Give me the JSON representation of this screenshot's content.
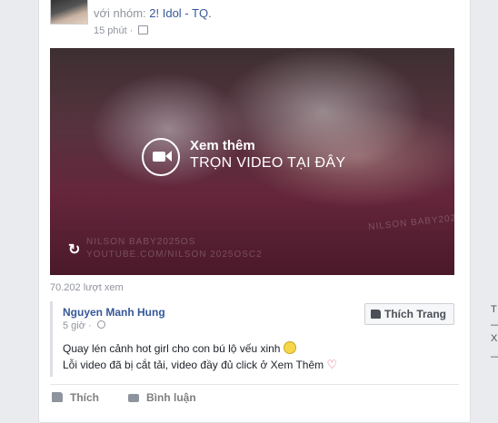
{
  "post": {
    "prefix": "với nhóm:",
    "group": "2! Idol - TQ.",
    "time": "15 phút",
    "privacy_icon": "audience-icon"
  },
  "video": {
    "cta_line1": "Xem thêm",
    "cta_line2": "TRỌN VIDEO TẠI ĐÂY",
    "watermark1": "NILSON BABY2025OSOS",
    "watermark2": "NILSON BABY2025OS",
    "watermark3": "YOUTUBE.COM/NILSON 2025OSC2",
    "replay_symbol": "↻",
    "views": "70.202 lượt xem"
  },
  "shared": {
    "author": "Nguyen Manh Hung",
    "time": "5 giờ ·",
    "like_page_label": "Thích Trang",
    "line1": "Quay lén cảnh hot girl cho con bú lộ vếu xinh",
    "line2": "Lỗi video đã bị cắt tải, video đầy đủ click ở Xem Thêm",
    "heart": "♡"
  },
  "actions": {
    "like": "Thích",
    "comment": "Bình luận"
  },
  "sidebar_fragments": [
    "T",
    "—",
    "X",
    "—"
  ]
}
